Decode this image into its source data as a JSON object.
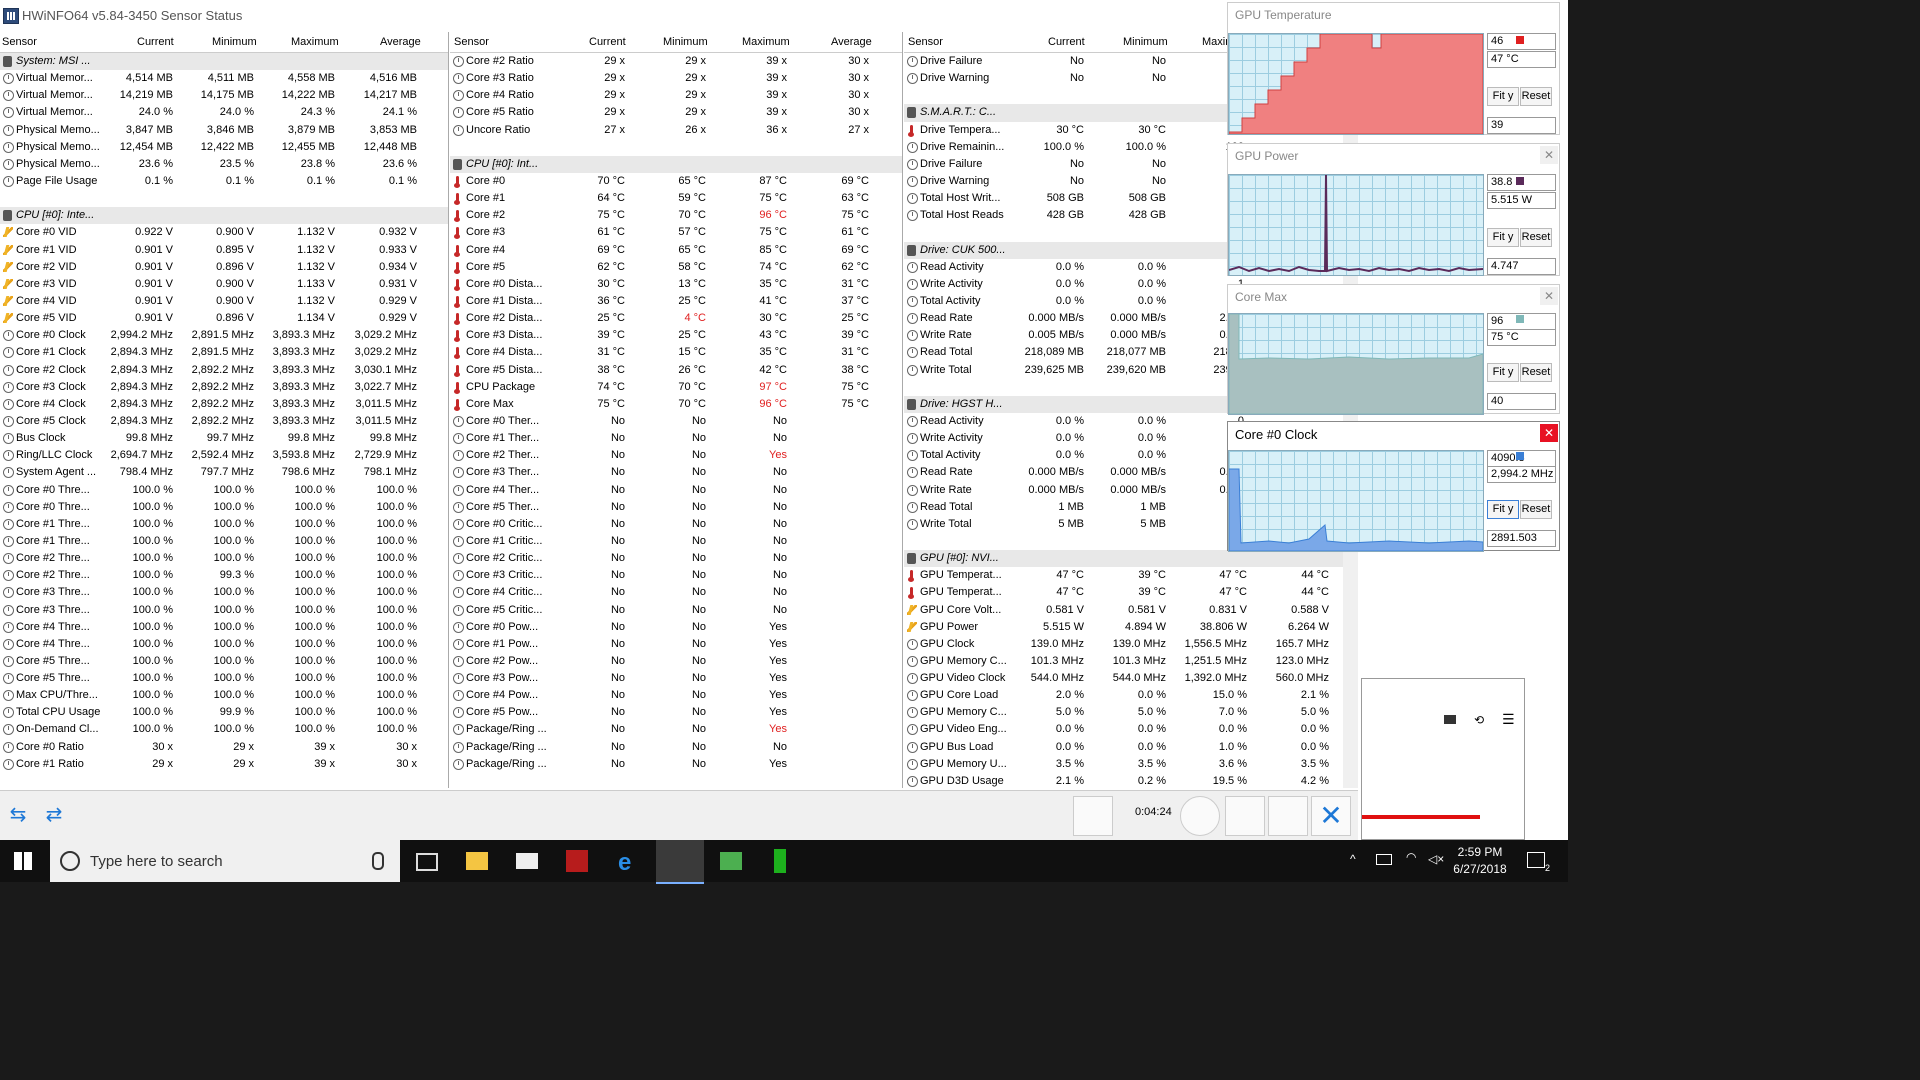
{
  "window": {
    "title": "HWiNFO64 v5.84-3450 Sensor Status"
  },
  "columns": [
    "Sensor",
    "Current",
    "Minimum",
    "Maximum",
    "Average"
  ],
  "panel1": [
    {
      "t": "grp",
      "n": "System: MSI ..."
    },
    {
      "t": "clock",
      "n": "Virtual Memor...",
      "c": "4,514 MB",
      "mi": "4,511 MB",
      "ma": "4,558 MB",
      "a": "4,516 MB"
    },
    {
      "t": "clock",
      "n": "Virtual Memor...",
      "c": "14,219 MB",
      "mi": "14,175 MB",
      "ma": "14,222 MB",
      "a": "14,217 MB"
    },
    {
      "t": "clock",
      "n": "Virtual Memor...",
      "c": "24.0 %",
      "mi": "24.0 %",
      "ma": "24.3 %",
      "a": "24.1 %"
    },
    {
      "t": "clock",
      "n": "Physical Memo...",
      "c": "3,847 MB",
      "mi": "3,846 MB",
      "ma": "3,879 MB",
      "a": "3,853 MB"
    },
    {
      "t": "clock",
      "n": "Physical Memo...",
      "c": "12,454 MB",
      "mi": "12,422 MB",
      "ma": "12,455 MB",
      "a": "12,448 MB"
    },
    {
      "t": "clock",
      "n": "Physical Memo...",
      "c": "23.6 %",
      "mi": "23.5 %",
      "ma": "23.8 %",
      "a": "23.6 %"
    },
    {
      "t": "clock",
      "n": "Page File Usage",
      "c": "0.1 %",
      "mi": "0.1 %",
      "ma": "0.1 %",
      "a": "0.1 %"
    },
    {
      "t": "blank",
      "n": ""
    },
    {
      "t": "grp",
      "n": "CPU [#0]: Inte..."
    },
    {
      "t": "volt",
      "n": "Core #0 VID",
      "c": "0.922 V",
      "mi": "0.900 V",
      "ma": "1.132 V",
      "a": "0.932 V"
    },
    {
      "t": "volt",
      "n": "Core #1 VID",
      "c": "0.901 V",
      "mi": "0.895 V",
      "ma": "1.132 V",
      "a": "0.933 V"
    },
    {
      "t": "volt",
      "n": "Core #2 VID",
      "c": "0.901 V",
      "mi": "0.896 V",
      "ma": "1.132 V",
      "a": "0.934 V"
    },
    {
      "t": "volt",
      "n": "Core #3 VID",
      "c": "0.901 V",
      "mi": "0.900 V",
      "ma": "1.133 V",
      "a": "0.931 V"
    },
    {
      "t": "volt",
      "n": "Core #4 VID",
      "c": "0.901 V",
      "mi": "0.900 V",
      "ma": "1.132 V",
      "a": "0.929 V"
    },
    {
      "t": "volt",
      "n": "Core #5 VID",
      "c": "0.901 V",
      "mi": "0.896 V",
      "ma": "1.134 V",
      "a": "0.929 V"
    },
    {
      "t": "clock",
      "n": "Core #0 Clock",
      "c": "2,994.2 MHz",
      "mi": "2,891.5 MHz",
      "ma": "3,893.3 MHz",
      "a": "3,029.2 MHz"
    },
    {
      "t": "clock",
      "n": "Core #1 Clock",
      "c": "2,894.3 MHz",
      "mi": "2,891.5 MHz",
      "ma": "3,893.3 MHz",
      "a": "3,029.2 MHz"
    },
    {
      "t": "clock",
      "n": "Core #2 Clock",
      "c": "2,894.3 MHz",
      "mi": "2,892.2 MHz",
      "ma": "3,893.3 MHz",
      "a": "3,030.1 MHz"
    },
    {
      "t": "clock",
      "n": "Core #3 Clock",
      "c": "2,894.3 MHz",
      "mi": "2,892.2 MHz",
      "ma": "3,893.3 MHz",
      "a": "3,022.7 MHz"
    },
    {
      "t": "clock",
      "n": "Core #4 Clock",
      "c": "2,894.3 MHz",
      "mi": "2,892.2 MHz",
      "ma": "3,893.3 MHz",
      "a": "3,011.5 MHz"
    },
    {
      "t": "clock",
      "n": "Core #5 Clock",
      "c": "2,894.3 MHz",
      "mi": "2,892.2 MHz",
      "ma": "3,893.3 MHz",
      "a": "3,011.5 MHz"
    },
    {
      "t": "clock",
      "n": "Bus Clock",
      "c": "99.8 MHz",
      "mi": "99.7 MHz",
      "ma": "99.8 MHz",
      "a": "99.8 MHz"
    },
    {
      "t": "clock",
      "n": "Ring/LLC Clock",
      "c": "2,694.7 MHz",
      "mi": "2,592.4 MHz",
      "ma": "3,593.8 MHz",
      "a": "2,729.9 MHz"
    },
    {
      "t": "clock",
      "n": "System Agent ...",
      "c": "798.4 MHz",
      "mi": "797.7 MHz",
      "ma": "798.6 MHz",
      "a": "798.1 MHz"
    },
    {
      "t": "clock",
      "n": "Core #0 Thre...",
      "c": "100.0 %",
      "mi": "100.0 %",
      "ma": "100.0 %",
      "a": "100.0 %"
    },
    {
      "t": "clock",
      "n": "Core #0 Thre...",
      "c": "100.0 %",
      "mi": "100.0 %",
      "ma": "100.0 %",
      "a": "100.0 %"
    },
    {
      "t": "clock",
      "n": "Core #1 Thre...",
      "c": "100.0 %",
      "mi": "100.0 %",
      "ma": "100.0 %",
      "a": "100.0 %"
    },
    {
      "t": "clock",
      "n": "Core #1 Thre...",
      "c": "100.0 %",
      "mi": "100.0 %",
      "ma": "100.0 %",
      "a": "100.0 %"
    },
    {
      "t": "clock",
      "n": "Core #2 Thre...",
      "c": "100.0 %",
      "mi": "100.0 %",
      "ma": "100.0 %",
      "a": "100.0 %"
    },
    {
      "t": "clock",
      "n": "Core #2 Thre...",
      "c": "100.0 %",
      "mi": "99.3 %",
      "ma": "100.0 %",
      "a": "100.0 %"
    },
    {
      "t": "clock",
      "n": "Core #3 Thre...",
      "c": "100.0 %",
      "mi": "100.0 %",
      "ma": "100.0 %",
      "a": "100.0 %"
    },
    {
      "t": "clock",
      "n": "Core #3 Thre...",
      "c": "100.0 %",
      "mi": "100.0 %",
      "ma": "100.0 %",
      "a": "100.0 %"
    },
    {
      "t": "clock",
      "n": "Core #4 Thre...",
      "c": "100.0 %",
      "mi": "100.0 %",
      "ma": "100.0 %",
      "a": "100.0 %"
    },
    {
      "t": "clock",
      "n": "Core #4 Thre...",
      "c": "100.0 %",
      "mi": "100.0 %",
      "ma": "100.0 %",
      "a": "100.0 %"
    },
    {
      "t": "clock",
      "n": "Core #5 Thre...",
      "c": "100.0 %",
      "mi": "100.0 %",
      "ma": "100.0 %",
      "a": "100.0 %"
    },
    {
      "t": "clock",
      "n": "Core #5 Thre...",
      "c": "100.0 %",
      "mi": "100.0 %",
      "ma": "100.0 %",
      "a": "100.0 %"
    },
    {
      "t": "clock",
      "n": "Max CPU/Thre...",
      "c": "100.0 %",
      "mi": "100.0 %",
      "ma": "100.0 %",
      "a": "100.0 %"
    },
    {
      "t": "clock",
      "n": "Total CPU Usage",
      "c": "100.0 %",
      "mi": "99.9 %",
      "ma": "100.0 %",
      "a": "100.0 %"
    },
    {
      "t": "clock",
      "n": "On-Demand Cl...",
      "c": "100.0 %",
      "mi": "100.0 %",
      "ma": "100.0 %",
      "a": "100.0 %"
    },
    {
      "t": "clock",
      "n": "Core #0 Ratio",
      "c": "30 x",
      "mi": "29 x",
      "ma": "39 x",
      "a": "30 x"
    },
    {
      "t": "clock",
      "n": "Core #1 Ratio",
      "c": "29 x",
      "mi": "29 x",
      "ma": "39 x",
      "a": "30 x"
    }
  ],
  "panel2": [
    {
      "t": "clock",
      "n": "Core #2 Ratio",
      "c": "29 x",
      "mi": "29 x",
      "ma": "39 x",
      "a": "30 x"
    },
    {
      "t": "clock",
      "n": "Core #3 Ratio",
      "c": "29 x",
      "mi": "29 x",
      "ma": "39 x",
      "a": "30 x"
    },
    {
      "t": "clock",
      "n": "Core #4 Ratio",
      "c": "29 x",
      "mi": "29 x",
      "ma": "39 x",
      "a": "30 x"
    },
    {
      "t": "clock",
      "n": "Core #5 Ratio",
      "c": "29 x",
      "mi": "29 x",
      "ma": "39 x",
      "a": "30 x"
    },
    {
      "t": "clock",
      "n": "Uncore Ratio",
      "c": "27 x",
      "mi": "26 x",
      "ma": "36 x",
      "a": "27 x"
    },
    {
      "t": "blank",
      "n": ""
    },
    {
      "t": "grp",
      "n": "CPU [#0]: Int..."
    },
    {
      "t": "temp",
      "n": "Core #0",
      "c": "70 °C",
      "mi": "65 °C",
      "ma": "87 °C",
      "a": "69 °C"
    },
    {
      "t": "temp",
      "n": "Core #1",
      "c": "64 °C",
      "mi": "59 °C",
      "ma": "75 °C",
      "a": "63 °C"
    },
    {
      "t": "temp",
      "n": "Core #2",
      "c": "75 °C",
      "mi": "70 °C",
      "ma": "96 °C",
      "a": "75 °C",
      "red": "ma"
    },
    {
      "t": "temp",
      "n": "Core #3",
      "c": "61 °C",
      "mi": "57 °C",
      "ma": "75 °C",
      "a": "61 °C"
    },
    {
      "t": "temp",
      "n": "Core #4",
      "c": "69 °C",
      "mi": "65 °C",
      "ma": "85 °C",
      "a": "69 °C"
    },
    {
      "t": "temp",
      "n": "Core #5",
      "c": "62 °C",
      "mi": "58 °C",
      "ma": "74 °C",
      "a": "62 °C"
    },
    {
      "t": "temp",
      "n": "Core #0 Dista...",
      "c": "30 °C",
      "mi": "13 °C",
      "ma": "35 °C",
      "a": "31 °C"
    },
    {
      "t": "temp",
      "n": "Core #1 Dista...",
      "c": "36 °C",
      "mi": "25 °C",
      "ma": "41 °C",
      "a": "37 °C"
    },
    {
      "t": "temp",
      "n": "Core #2 Dista...",
      "c": "25 °C",
      "mi": "4 °C",
      "ma": "30 °C",
      "a": "25 °C",
      "red": "mi"
    },
    {
      "t": "temp",
      "n": "Core #3 Dista...",
      "c": "39 °C",
      "mi": "25 °C",
      "ma": "43 °C",
      "a": "39 °C"
    },
    {
      "t": "temp",
      "n": "Core #4 Dista...",
      "c": "31 °C",
      "mi": "15 °C",
      "ma": "35 °C",
      "a": "31 °C"
    },
    {
      "t": "temp",
      "n": "Core #5 Dista...",
      "c": "38 °C",
      "mi": "26 °C",
      "ma": "42 °C",
      "a": "38 °C"
    },
    {
      "t": "temp",
      "n": "CPU Package",
      "c": "74 °C",
      "mi": "70 °C",
      "ma": "97 °C",
      "a": "75 °C",
      "red": "ma"
    },
    {
      "t": "temp",
      "n": "Core Max",
      "c": "75 °C",
      "mi": "70 °C",
      "ma": "96 °C",
      "a": "75 °C",
      "red": "ma"
    },
    {
      "t": "clock",
      "n": "Core #0 Ther...",
      "c": "No",
      "mi": "No",
      "ma": "No",
      "a": ""
    },
    {
      "t": "clock",
      "n": "Core #1 Ther...",
      "c": "No",
      "mi": "No",
      "ma": "No",
      "a": ""
    },
    {
      "t": "clock",
      "n": "Core #2 Ther...",
      "c": "No",
      "mi": "No",
      "ma": "Yes",
      "a": "",
      "red": "ma"
    },
    {
      "t": "clock",
      "n": "Core #3 Ther...",
      "c": "No",
      "mi": "No",
      "ma": "No",
      "a": ""
    },
    {
      "t": "clock",
      "n": "Core #4 Ther...",
      "c": "No",
      "mi": "No",
      "ma": "No",
      "a": ""
    },
    {
      "t": "clock",
      "n": "Core #5 Ther...",
      "c": "No",
      "mi": "No",
      "ma": "No",
      "a": ""
    },
    {
      "t": "clock",
      "n": "Core #0 Critic...",
      "c": "No",
      "mi": "No",
      "ma": "No",
      "a": ""
    },
    {
      "t": "clock",
      "n": "Core #1 Critic...",
      "c": "No",
      "mi": "No",
      "ma": "No",
      "a": ""
    },
    {
      "t": "clock",
      "n": "Core #2 Critic...",
      "c": "No",
      "mi": "No",
      "ma": "No",
      "a": ""
    },
    {
      "t": "clock",
      "n": "Core #3 Critic...",
      "c": "No",
      "mi": "No",
      "ma": "No",
      "a": ""
    },
    {
      "t": "clock",
      "n": "Core #4 Critic...",
      "c": "No",
      "mi": "No",
      "ma": "No",
      "a": ""
    },
    {
      "t": "clock",
      "n": "Core #5 Critic...",
      "c": "No",
      "mi": "No",
      "ma": "No",
      "a": ""
    },
    {
      "t": "clock",
      "n": "Core #0 Pow...",
      "c": "No",
      "mi": "No",
      "ma": "Yes",
      "a": ""
    },
    {
      "t": "clock",
      "n": "Core #1 Pow...",
      "c": "No",
      "mi": "No",
      "ma": "Yes",
      "a": ""
    },
    {
      "t": "clock",
      "n": "Core #2 Pow...",
      "c": "No",
      "mi": "No",
      "ma": "Yes",
      "a": ""
    },
    {
      "t": "clock",
      "n": "Core #3 Pow...",
      "c": "No",
      "mi": "No",
      "ma": "Yes",
      "a": ""
    },
    {
      "t": "clock",
      "n": "Core #4 Pow...",
      "c": "No",
      "mi": "No",
      "ma": "Yes",
      "a": ""
    },
    {
      "t": "clock",
      "n": "Core #5 Pow...",
      "c": "No",
      "mi": "No",
      "ma": "Yes",
      "a": ""
    },
    {
      "t": "clock",
      "n": "Package/Ring ...",
      "c": "No",
      "mi": "No",
      "ma": "Yes",
      "a": "",
      "red": "ma"
    },
    {
      "t": "clock",
      "n": "Package/Ring ...",
      "c": "No",
      "mi": "No",
      "ma": "No",
      "a": ""
    },
    {
      "t": "clock",
      "n": "Package/Ring ...",
      "c": "No",
      "mi": "No",
      "ma": "Yes",
      "a": ""
    }
  ],
  "panel3": [
    {
      "t": "clock",
      "n": "Drive Failure",
      "c": "No",
      "mi": "No",
      "ma": "",
      "a": ""
    },
    {
      "t": "clock",
      "n": "Drive Warning",
      "c": "No",
      "mi": "No",
      "ma": "",
      "a": ""
    },
    {
      "t": "blank",
      "n": ""
    },
    {
      "t": "grp",
      "n": "S.M.A.R.T.: C..."
    },
    {
      "t": "temp",
      "n": "Drive Tempera...",
      "c": "30 °C",
      "mi": "30 °C",
      "ma": "3",
      "a": ""
    },
    {
      "t": "clock",
      "n": "Drive Remainin...",
      "c": "100.0 %",
      "mi": "100.0 %",
      "ma": "100.",
      "a": ""
    },
    {
      "t": "clock",
      "n": "Drive Failure",
      "c": "No",
      "mi": "No",
      "ma": "",
      "a": ""
    },
    {
      "t": "clock",
      "n": "Drive Warning",
      "c": "No",
      "mi": "No",
      "ma": "",
      "a": ""
    },
    {
      "t": "clock",
      "n": "Total Host Writ...",
      "c": "508 GB",
      "mi": "508 GB",
      "ma": "50",
      "a": ""
    },
    {
      "t": "clock",
      "n": "Total Host Reads",
      "c": "428 GB",
      "mi": "428 GB",
      "ma": "42",
      "a": ""
    },
    {
      "t": "blank",
      "n": ""
    },
    {
      "t": "grp",
      "n": "Drive: CUK 500..."
    },
    {
      "t": "clock",
      "n": "Read Activity",
      "c": "0.0 %",
      "mi": "0.0 %",
      "ma": "2",
      "a": ""
    },
    {
      "t": "clock",
      "n": "Write Activity",
      "c": "0.0 %",
      "mi": "0.0 %",
      "ma": "1.",
      "a": ""
    },
    {
      "t": "clock",
      "n": "Total Activity",
      "c": "0.0 %",
      "mi": "0.0 %",
      "ma": "",
      "a": ""
    },
    {
      "t": "clock",
      "n": "Read Rate",
      "c": "0.000 MB/s",
      "mi": "0.000 MB/s",
      "ma": "2.525",
      "a": ""
    },
    {
      "t": "clock",
      "n": "Write Rate",
      "c": "0.005 MB/s",
      "mi": "0.000 MB/s",
      "ma": "0.168",
      "a": ""
    },
    {
      "t": "clock",
      "n": "Read Total",
      "c": "218,089 MB",
      "mi": "218,077 MB",
      "ma": "218,08",
      "a": ""
    },
    {
      "t": "clock",
      "n": "Write Total",
      "c": "239,625 MB",
      "mi": "239,620 MB",
      "ma": "239,62",
      "a": ""
    },
    {
      "t": "blank",
      "n": ""
    },
    {
      "t": "grp",
      "n": "Drive: HGST H..."
    },
    {
      "t": "clock",
      "n": "Read Activity",
      "c": "0.0 %",
      "mi": "0.0 %",
      "ma": "0.",
      "a": ""
    },
    {
      "t": "clock",
      "n": "Write Activity",
      "c": "0.0 %",
      "mi": "0.0 %",
      "ma": "0.",
      "a": ""
    },
    {
      "t": "clock",
      "n": "Total Activity",
      "c": "0.0 %",
      "mi": "0.0 %",
      "ma": "0.",
      "a": ""
    },
    {
      "t": "clock",
      "n": "Read Rate",
      "c": "0.000 MB/s",
      "mi": "0.000 MB/s",
      "ma": "0.000",
      "a": ""
    },
    {
      "t": "clock",
      "n": "Write Rate",
      "c": "0.000 MB/s",
      "mi": "0.000 MB/s",
      "ma": "0.000",
      "a": ""
    },
    {
      "t": "clock",
      "n": "Read Total",
      "c": "1 MB",
      "mi": "1 MB",
      "ma": "",
      "a": ""
    },
    {
      "t": "clock",
      "n": "Write Total",
      "c": "5 MB",
      "mi": "5 MB",
      "ma": "5",
      "a": ""
    },
    {
      "t": "blank",
      "n": ""
    },
    {
      "t": "grp",
      "n": "GPU [#0]: NVI..."
    },
    {
      "t": "temp",
      "n": "GPU Temperat...",
      "c": "47 °C",
      "mi": "39 °C",
      "ma": "47 °C",
      "a": "44 °C"
    },
    {
      "t": "temp",
      "n": "GPU Temperat...",
      "c": "47 °C",
      "mi": "39 °C",
      "ma": "47 °C",
      "a": "44 °C"
    },
    {
      "t": "volt",
      "n": "GPU Core Volt...",
      "c": "0.581 V",
      "mi": "0.581 V",
      "ma": "0.831 V",
      "a": "0.588 V"
    },
    {
      "t": "volt",
      "n": "GPU Power",
      "c": "5.515 W",
      "mi": "4.894 W",
      "ma": "38.806 W",
      "a": "6.264 W"
    },
    {
      "t": "clock",
      "n": "GPU Clock",
      "c": "139.0 MHz",
      "mi": "139.0 MHz",
      "ma": "1,556.5 MHz",
      "a": "165.7 MHz"
    },
    {
      "t": "clock",
      "n": "GPU Memory C...",
      "c": "101.3 MHz",
      "mi": "101.3 MHz",
      "ma": "1,251.5 MHz",
      "a": "123.0 MHz"
    },
    {
      "t": "clock",
      "n": "GPU Video Clock",
      "c": "544.0 MHz",
      "mi": "544.0 MHz",
      "ma": "1,392.0 MHz",
      "a": "560.0 MHz"
    },
    {
      "t": "clock",
      "n": "GPU Core Load",
      "c": "2.0 %",
      "mi": "0.0 %",
      "ma": "15.0 %",
      "a": "2.1 %"
    },
    {
      "t": "clock",
      "n": "GPU Memory C...",
      "c": "5.0 %",
      "mi": "5.0 %",
      "ma": "7.0 %",
      "a": "5.0 %"
    },
    {
      "t": "clock",
      "n": "GPU Video Eng...",
      "c": "0.0 %",
      "mi": "0.0 %",
      "ma": "0.0 %",
      "a": "0.0 %"
    },
    {
      "t": "clock",
      "n": "GPU Bus Load",
      "c": "0.0 %",
      "mi": "0.0 %",
      "ma": "1.0 %",
      "a": "0.0 %"
    },
    {
      "t": "clock",
      "n": "GPU Memory U...",
      "c": "3.5 %",
      "mi": "3.5 %",
      "ma": "3.6 %",
      "a": "3.5 %"
    },
    {
      "t": "clock",
      "n": "GPU D3D Usage",
      "c": "2.1 %",
      "mi": "0.2 %",
      "ma": "19.5 %",
      "a": "4.2 %"
    }
  ],
  "status": {
    "elapsed": "0:04:24"
  },
  "graphs": [
    {
      "title": "GPU Temperature",
      "top_value": "46",
      "current": "47 °C",
      "bottom_value": "39",
      "fit": "Fit y",
      "reset": "Reset",
      "color": "#f08080"
    },
    {
      "title": "GPU Power",
      "top_value": "38.8",
      "current": "5.515 W",
      "bottom_value": "4.747",
      "fit": "Fit y",
      "reset": "Reset",
      "color": "#5a2a5a"
    },
    {
      "title": "Core Max",
      "top_value": "96",
      "current": "75 °C",
      "bottom_value": "40",
      "fit": "Fit y",
      "reset": "Reset",
      "color": "#7fb8b8"
    },
    {
      "title": "Core #0 Clock",
      "top_value": "4090.3",
      "current": "2,994.2 MHz",
      "bottom_value": "2891.503",
      "fit": "Fit y",
      "reset": "Reset",
      "color": "#3a7fd6"
    }
  ],
  "taskbar": {
    "search_placeholder": "Type here to search",
    "time": "2:59 PM",
    "date": "6/27/2018",
    "notify_count": "2"
  }
}
